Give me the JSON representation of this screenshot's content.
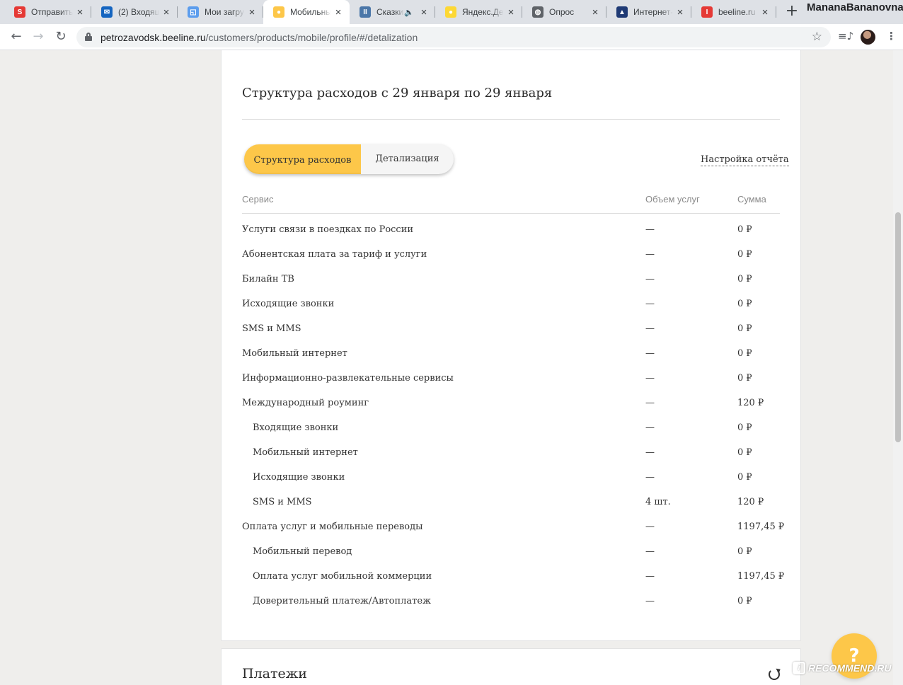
{
  "browser": {
    "tabs": [
      {
        "title": "Отправить",
        "favicon_color": "#e53935",
        "favicon_glyph": "S"
      },
      {
        "title": "(2) Входящ",
        "favicon_color": "#1565c0",
        "favicon_glyph": "✉"
      },
      {
        "title": "Мои загру",
        "favicon_color": "#5c9ded",
        "favicon_glyph": "◱"
      },
      {
        "title": "Мобильны",
        "favicon_color": "#fdc749",
        "favicon_glyph": "●",
        "active": true
      },
      {
        "title": "Сказки",
        "favicon_color": "#4a76a8",
        "favicon_glyph": "II",
        "audio": true
      },
      {
        "title": "Яндекс.Де",
        "favicon_color": "#fdd835",
        "favicon_glyph": "●"
      },
      {
        "title": "Опрос",
        "favicon_color": "#5f6368",
        "favicon_glyph": "◍"
      },
      {
        "title": "Интернет-",
        "favicon_color": "#1f3a75",
        "favicon_glyph": "▲"
      },
      {
        "title": "beeline.ru",
        "favicon_color": "#e53935",
        "favicon_glyph": "I"
      }
    ],
    "new_tab": "+",
    "profile_name": "MananaBananovna",
    "url_host": "petrozavodsk.beeline.ru",
    "url_path": "/customers/products/mobile/profile/#/detalization"
  },
  "report": {
    "title": "Структура расходов с 29 января по 29 января",
    "tabs": {
      "active": "Структура расходов",
      "inactive": "Детализация"
    },
    "settings_link": "Настройка отчёта",
    "columns": {
      "service": "Сервис",
      "volume": "Объем услуг",
      "sum": "Сумма"
    },
    "rows": [
      {
        "service": "Услуги связи в поездках по России",
        "volume": "—",
        "sum": "0 ₽",
        "sub": false
      },
      {
        "service": "Абонентская плата за тариф и услуги",
        "volume": "—",
        "sum": "0 ₽",
        "sub": false
      },
      {
        "service": "Билайн ТВ",
        "volume": "—",
        "sum": "0 ₽",
        "sub": false
      },
      {
        "service": "Исходящие звонки",
        "volume": "—",
        "sum": "0 ₽",
        "sub": false
      },
      {
        "service": "SMS и MMS",
        "volume": "—",
        "sum": "0 ₽",
        "sub": false
      },
      {
        "service": "Мобильный интернет",
        "volume": "—",
        "sum": "0 ₽",
        "sub": false
      },
      {
        "service": "Информационно-развлекательные сервисы",
        "volume": "—",
        "sum": "0 ₽",
        "sub": false
      },
      {
        "service": "Международный роуминг",
        "volume": "—",
        "sum": "120 ₽",
        "sub": false
      },
      {
        "service": "Входящие звонки",
        "volume": "—",
        "sum": "0 ₽",
        "sub": true
      },
      {
        "service": "Мобильный интернет",
        "volume": "—",
        "sum": "0 ₽",
        "sub": true
      },
      {
        "service": "Исходящие звонки",
        "volume": "—",
        "sum": "0 ₽",
        "sub": true
      },
      {
        "service": "SMS и MMS",
        "volume": "4 шт.",
        "sum": "120 ₽",
        "sub": true
      },
      {
        "service": "Оплата услуг и мобильные переводы",
        "volume": "—",
        "sum": "1197,45 ₽",
        "sub": false
      },
      {
        "service": "Мобильный перевод",
        "volume": "—",
        "sum": "0 ₽",
        "sub": true
      },
      {
        "service": "Оплата услуг мобильной коммерции",
        "volume": "—",
        "sum": "1197,45 ₽",
        "sub": true
      },
      {
        "service": "Доверительный платеж/Автоплатеж",
        "volume": "—",
        "sum": "0 ₽",
        "sub": true
      }
    ]
  },
  "payments": {
    "title": "Платежи"
  },
  "help": {
    "label": "?"
  },
  "watermark": {
    "badge": "i",
    "text": "RECOMMEND.RU"
  },
  "colors": {
    "accent": "#fdc749",
    "page_bg": "#efeeec",
    "text": "#333333"
  }
}
